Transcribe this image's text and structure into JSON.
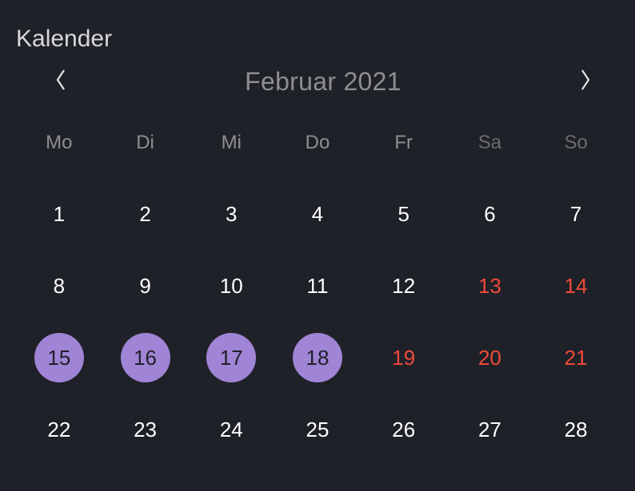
{
  "title": "Kalender",
  "monthLabel": "Februar 2021",
  "weekdays": [
    {
      "label": "Mo",
      "weekend": false
    },
    {
      "label": "Di",
      "weekend": false
    },
    {
      "label": "Mi",
      "weekend": false
    },
    {
      "label": "Do",
      "weekend": false
    },
    {
      "label": "Fr",
      "weekend": false
    },
    {
      "label": "Sa",
      "weekend": true
    },
    {
      "label": "So",
      "weekend": true
    }
  ],
  "days": [
    {
      "n": "1",
      "selected": false,
      "red": false
    },
    {
      "n": "2",
      "selected": false,
      "red": false
    },
    {
      "n": "3",
      "selected": false,
      "red": false
    },
    {
      "n": "4",
      "selected": false,
      "red": false
    },
    {
      "n": "5",
      "selected": false,
      "red": false
    },
    {
      "n": "6",
      "selected": false,
      "red": false
    },
    {
      "n": "7",
      "selected": false,
      "red": false
    },
    {
      "n": "8",
      "selected": false,
      "red": false
    },
    {
      "n": "9",
      "selected": false,
      "red": false
    },
    {
      "n": "10",
      "selected": false,
      "red": false
    },
    {
      "n": "11",
      "selected": false,
      "red": false
    },
    {
      "n": "12",
      "selected": false,
      "red": false
    },
    {
      "n": "13",
      "selected": false,
      "red": true
    },
    {
      "n": "14",
      "selected": false,
      "red": true
    },
    {
      "n": "15",
      "selected": true,
      "red": false
    },
    {
      "n": "16",
      "selected": true,
      "red": false
    },
    {
      "n": "17",
      "selected": true,
      "red": false
    },
    {
      "n": "18",
      "selected": true,
      "red": false
    },
    {
      "n": "19",
      "selected": false,
      "red": true
    },
    {
      "n": "20",
      "selected": false,
      "red": true
    },
    {
      "n": "21",
      "selected": false,
      "red": true
    },
    {
      "n": "22",
      "selected": false,
      "red": false
    },
    {
      "n": "23",
      "selected": false,
      "red": false
    },
    {
      "n": "24",
      "selected": false,
      "red": false
    },
    {
      "n": "25",
      "selected": false,
      "red": false
    },
    {
      "n": "26",
      "selected": false,
      "red": false
    },
    {
      "n": "27",
      "selected": false,
      "red": false
    },
    {
      "n": "28",
      "selected": false,
      "red": false
    }
  ]
}
